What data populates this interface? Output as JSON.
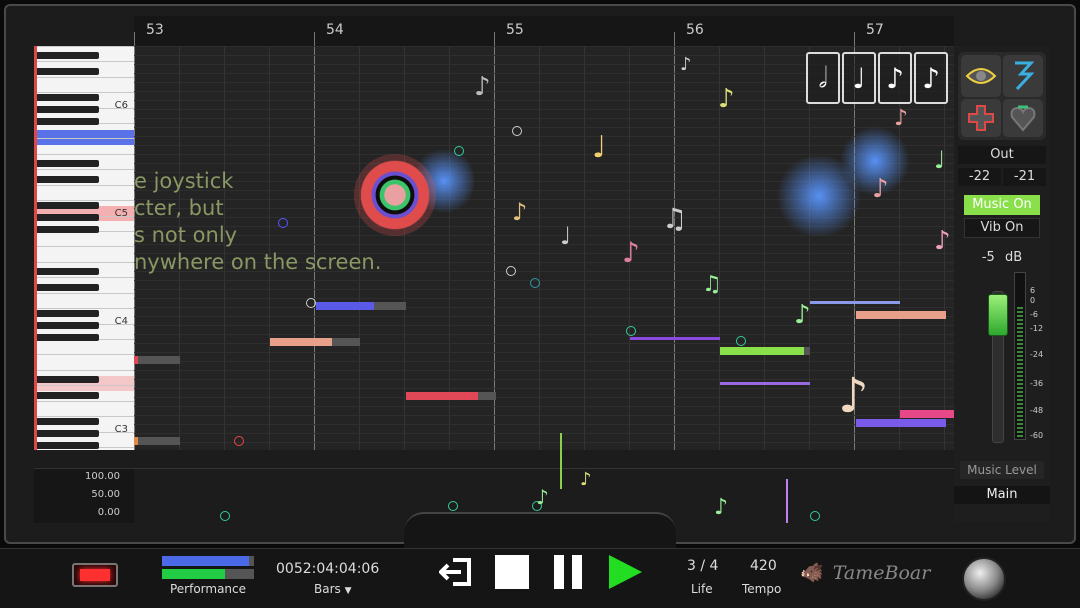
{
  "ruler": {
    "bars": [
      "53",
      "54",
      "55",
      "56",
      "57"
    ]
  },
  "keyboard": {
    "labels": [
      "C6",
      "C5",
      "C4",
      "C3"
    ]
  },
  "hint": {
    "lines": [
      "e joystick",
      "cter, but",
      "s not only",
      "nywhere on the screen."
    ]
  },
  "notes": [
    {
      "color": "#5a5ae8"
    },
    {
      "color": "#e8a08a"
    },
    {
      "color": "#e04858"
    },
    {
      "color": "#8a4ae0"
    },
    {
      "color": "#8ae04a"
    },
    {
      "color": "#9a6ae0"
    },
    {
      "color": "#8a9ae8"
    },
    {
      "color": "#e8a08a"
    },
    {
      "color": "#7a5ae8"
    },
    {
      "color": "#e84888"
    },
    {
      "color": "#e04858"
    },
    {
      "color": "#e08a48"
    }
  ],
  "note_buttons": [
    "𝅗𝅥",
    "♩",
    "♪",
    "♪"
  ],
  "right_panel": {
    "icons": [
      "eye-icon",
      "three-icon",
      "plus-icon",
      "heart-icon"
    ],
    "out_label": "Out",
    "out_left": "-22",
    "out_right": "-21",
    "music_on": "Music On",
    "vib_on": "Vib On",
    "db_value": "-5",
    "db_unit": "dB",
    "scale": [
      "6",
      "0",
      "-6",
      "-12",
      "-24",
      "-36",
      "-48",
      "-60"
    ],
    "music_level": "Music Level",
    "main": "Main"
  },
  "velocity": {
    "scale": [
      "100.00",
      "50.00",
      "0.00"
    ]
  },
  "transport": {
    "performance_label": "Performance",
    "performance_blue": 0.95,
    "performance_green": 0.68,
    "time": "0052:04:04:06",
    "time_unit": "Bars",
    "life": "3 / 4",
    "life_label": "Life",
    "tempo": "420",
    "tempo_label": "Tempo",
    "brand": "TameBoar",
    "colors": {
      "play": "#22dd22",
      "blue": "#4a6ae8",
      "green": "#22cc44"
    }
  }
}
